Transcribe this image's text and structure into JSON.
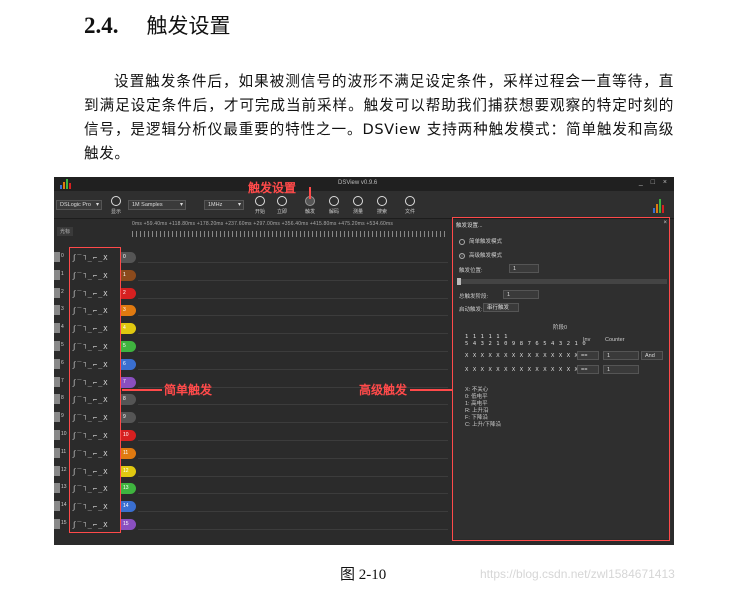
{
  "heading": {
    "number": "2.4.",
    "title": "触发设置"
  },
  "paragraph": "设置触发条件后，如果被测信号的波形不满足设定条件，采样过程会一直等待，直到满足设定条件后，才可完成当前采样。触发可以帮助我们捕获想要观察的特定时刻的信号，是逻辑分析仪最重要的特性之一。DSView 支持两种触发模式：简单触发和高级触发。",
  "figure": {
    "app_title": "DSView v0.9.6",
    "window_buttons": "_ □ ×",
    "toolbar": {
      "device_select": "DSLogic Pro",
      "samples_select": "1M Samples",
      "rate_select": "1MHz",
      "btn_show": "显示",
      "btn_start": "开始",
      "btn_instant": "立即",
      "btn_trigger": "触发",
      "btn_decode": "解码",
      "btn_measure": "测量",
      "btn_search": "搜索",
      "btn_file": "文件"
    },
    "ruler_label": "0ms  +59.40ms  +118.80ms  +178.20ms  +237.60ms  +297.00ms  +356.40ms  +415.80ms  +475.20ms  +534.60ms",
    "ruler_left": "光标",
    "waveform_glyphs": "ʃ‾˥_⌐_X",
    "channels": [
      {
        "label": "0",
        "tag": "0",
        "color": "#555555"
      },
      {
        "label": "1",
        "tag": "1",
        "color": "#8b4a1c"
      },
      {
        "label": "2",
        "tag": "2",
        "color": "#d62020"
      },
      {
        "label": "3",
        "tag": "3",
        "color": "#e07a10"
      },
      {
        "label": "4",
        "tag": "4",
        "color": "#e0c810"
      },
      {
        "label": "5",
        "tag": "5",
        "color": "#3fb43f"
      },
      {
        "label": "6",
        "tag": "6",
        "color": "#3a6fd0"
      },
      {
        "label": "7",
        "tag": "7",
        "color": "#8a4fc0"
      },
      {
        "label": "8",
        "tag": "8",
        "color": "#555555"
      },
      {
        "label": "9",
        "tag": "9",
        "color": "#555555"
      },
      {
        "label": "10",
        "tag": "10",
        "color": "#d62020"
      },
      {
        "label": "11",
        "tag": "11",
        "color": "#e07a10"
      },
      {
        "label": "12",
        "tag": "12",
        "color": "#e0c810"
      },
      {
        "label": "13",
        "tag": "13",
        "color": "#3fb43f"
      },
      {
        "label": "14",
        "tag": "14",
        "color": "#3a6fd0"
      },
      {
        "label": "15",
        "tag": "15",
        "color": "#8a4fc0"
      }
    ],
    "trigger_panel": {
      "title": "触发设置...",
      "radio_simple": "简单触发模式",
      "radio_advanced": "高级触发模式",
      "position_label": "触发位置:",
      "position_value": "1",
      "stages_label": "总触发阶段:",
      "stages_value": "1",
      "serial_label": "启动触发:",
      "serial_value": "串行触发",
      "stage_header": "阶段0",
      "bits_top": "1 1 1 1 1 1",
      "bits_bottom": "5 4 3 2 1 0 9 8 7 6 5 4 3 2 1 0",
      "col_inv": "Inv",
      "col_counter": "Counter",
      "x_row_1": "X X X X X X X X X X X X X X X X",
      "x_row_2": "X X X X X X X X X X X X X X X X",
      "op_1": "==",
      "op_2": "==",
      "counter_1": "1",
      "counter_2": "1",
      "logic_1": "And",
      "legend": [
        "X: 不关心",
        "0: 低电平",
        "1: 高电平",
        "R: 上升沿",
        "F: 下降沿",
        "C: 上升/下降沿"
      ]
    },
    "annotations": {
      "trigger_settings": "触发设置",
      "simple_trigger": "简单触发",
      "advanced_trigger": "高级触发"
    },
    "colors": {
      "annotation": "#ff4a4a",
      "background": "#2b2b2b"
    }
  },
  "caption": "图 2-10",
  "watermark": "https://blog.csdn.net/zwl1584671413"
}
